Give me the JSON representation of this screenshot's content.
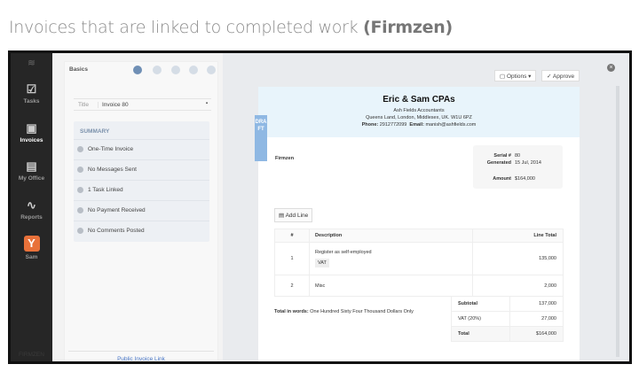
{
  "caption": {
    "text": "Invoices that are linked to completed work ",
    "bold": "(Firmzen)"
  },
  "sidebar": {
    "items": [
      {
        "label": "Tasks",
        "icon": "tasks-icon"
      },
      {
        "label": "Invoices",
        "icon": "invoices-icon"
      },
      {
        "label": "My Office",
        "icon": "briefcase-icon"
      },
      {
        "label": "Reports",
        "icon": "pulse-icon"
      },
      {
        "label": "Sam",
        "icon": "Y"
      }
    ],
    "brand": "FIRMZEN"
  },
  "left": {
    "section": "Basics",
    "title_label": "Title",
    "title_value": "Invoice 80",
    "summary_heading": "SUMMARY",
    "summary": [
      "One-Time Invoice",
      "No Messages Sent",
      "1 Task Linked",
      "No Payment Received",
      "No Comments Posted"
    ],
    "public_link": "Public Invoice Link"
  },
  "toolbar": {
    "options": "Options",
    "approve": "Approve"
  },
  "draft": "DRAFT",
  "invoice": {
    "company": "Eric & Sam CPAs",
    "subtitle": "Ash Fields Accountants",
    "address": "Queens Land, London, Middlesex, UK. W1U 6PZ",
    "phone_label": "Phone:",
    "phone": "2912772099",
    "email_label": "Email:",
    "email": "manish@ashfields.com",
    "client": "Firmzen",
    "serial_label": "Serial #",
    "serial": "80",
    "generated_label": "Generated",
    "generated": "15 Jul, 2014",
    "amount_label": "Amount",
    "amount": "$164,000",
    "add_line": "Add Line",
    "headers": [
      "#",
      "Description",
      "Line Total"
    ],
    "lines": [
      {
        "n": "1",
        "desc": "Register as self-employed",
        "tag": "VAT",
        "total": "135,000"
      },
      {
        "n": "2",
        "desc": "Misc",
        "total": "2,000"
      }
    ],
    "words_label": "Total in words:",
    "words": "One Hundred Sixty Four Thousand Dollars Only",
    "subtotal_label": "Subtotal",
    "subtotal": "137,000",
    "vat_label": "VAT (20%)",
    "vat": "27,000",
    "total_label": "Total",
    "total": "$164,000"
  }
}
